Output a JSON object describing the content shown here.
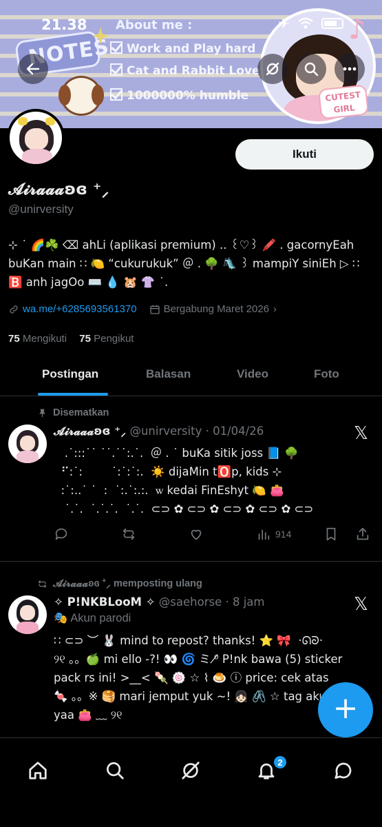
{
  "status_bar": {
    "time": "21.38"
  },
  "banner": {
    "notes_badge": "NOTES",
    "about_title": "About me :",
    "about_lines": [
      "Work and Play hard",
      "Cat and Rabbit Lovers",
      "1000000% humble"
    ],
    "sticker_text": "CUTEST GIRL"
  },
  "profile": {
    "display_name": "𝓐𝓲𝓻𝓪𝓪𝓪ʚɞ ⁺⸝",
    "handle": "@unirversity",
    "follow_button": "Ikuti",
    "bio_lines": [
      "⊹ ˙ 🌈☘️ ⌫ ahLi (aplikasi premium) .. ꒰♡꒱ 🖍️ . gacornyEah",
      "buKan main ∷ 🍋 “cukurukuk” ＠ . 🌳 🛝 ꒱ mampiY siniEh ▷ ∷",
      "🅱️ anh jagOo ⌨️ 💧 🐹 👚 ˙."
    ],
    "link": "wa.me/+6285693561370",
    "joined": "Bergabung Maret 2026",
    "following_count": "75",
    "following_label": "Mengikuti",
    "followers_count": "75",
    "followers_label": "Pengikut"
  },
  "tabs": [
    "Postingan",
    "Balasan",
    "Video",
    "Foto"
  ],
  "active_tab": "Postingan",
  "posts": [
    {
      "context": "Disematkan",
      "name": "𝓐𝓲𝓻𝓪𝓪𝓪ʚɞ ⁺⸝",
      "handle_time": "@unirversity · 01/04/26",
      "lines": [
        "   .˙:::˙˙ ˙˙.˙˙:.˙.  ＠ . ˙ buKa sitik joss 📘 🌳",
        "  ⠋:˙:        ˙:˙:˙:.  ☀️ dijaMin t🅾️p, kids ⊹",
        "  :˙:..˙ ˙  :  ˙:.˙:.:.  ꮃ kedai FinEshyt 🍋 👛",
        "   ˙.˙.  ˙.˙.˙.  ˙.˙.  ⊂⊃ ✿ ⊂⊃ ✿ ⊂⊃ ✿ ⊂⊃ ✿ ⊂⊃"
      ],
      "actions": {
        "reply": "",
        "repost": "",
        "like": "",
        "views": "914"
      }
    },
    {
      "context": "𝓐𝓲𝓻𝓪𝓪𝓪ʚɞ ⁺⸝ memposting ulang",
      "name": "✧ P!NKBLooM ✧",
      "handle_time": "@saehorse · 8 jam",
      "parody_label": "Akun parodi",
      "lines": [
        "∷ ⊂⊃ ︶ 🐰 mind to repost? thanks! ⭐ 🎀  ·ᘏᘐ·",
        "",
        "୨୧ 。。🍏 mi ello -?! 👀 🌀 ミ ⁰̸ P!nk bawa (5) sticker",
        "pack rs ini! >__< 🍡 🍥 ☆ ⌇ 🍮 ⓘ price: cek atas",
        "🍬 。。※ 🥞 mari jemput yuk ~! 👧🏻 🖇️ ☆ tag aku",
        "yaa 👛 ﹏ ୨୧"
      ]
    }
  ],
  "bottom_nav": {
    "notification_count": "2"
  }
}
